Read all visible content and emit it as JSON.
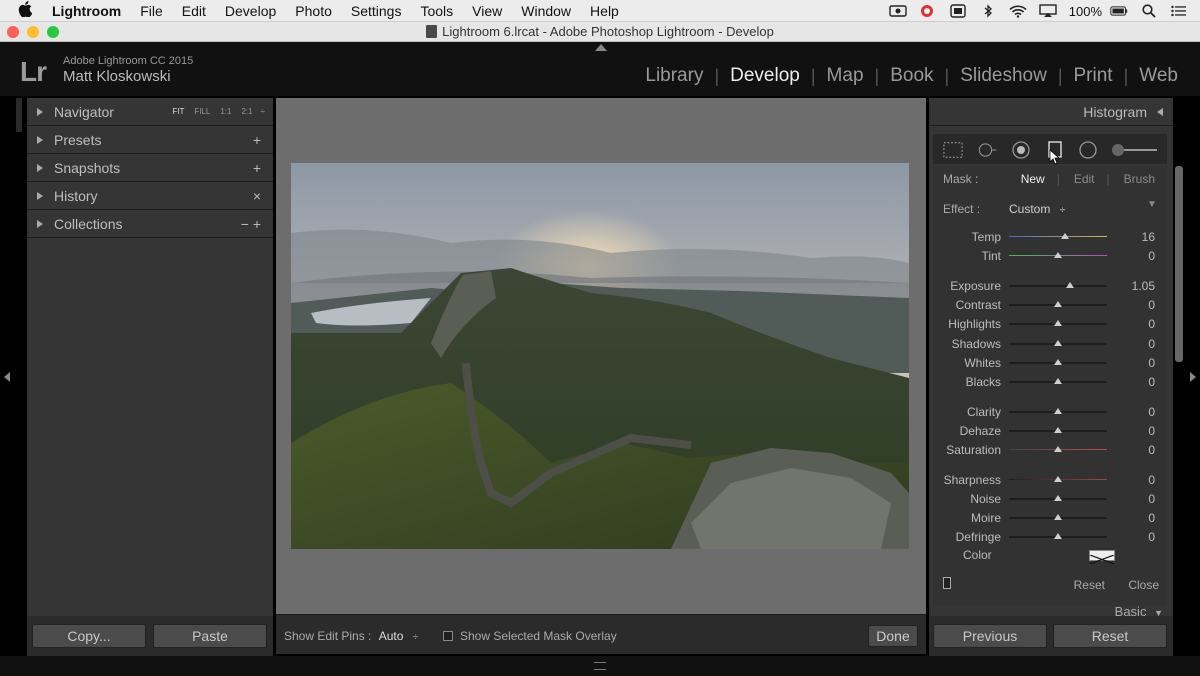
{
  "menubar": {
    "app_name": "Lightroom",
    "items": [
      "File",
      "Edit",
      "Develop",
      "Photo",
      "Settings",
      "Tools",
      "View",
      "Window",
      "Help"
    ],
    "battery": "100%"
  },
  "window": {
    "title": "Lightroom 6.lrcat - Adobe Photoshop Lightroom - Develop"
  },
  "header": {
    "logo": "Lr",
    "product": "Adobe Lightroom CC 2015",
    "user": "Matt Kloskowski",
    "modules": [
      "Library",
      "Develop",
      "Map",
      "Book",
      "Slideshow",
      "Print",
      "Web"
    ],
    "active_module": "Develop"
  },
  "left_panel": {
    "navigator": {
      "label": "Navigator",
      "zoom_options": [
        "FIT",
        "FILL",
        "1:1",
        "2:1"
      ],
      "zoom_more": "÷"
    },
    "sections": [
      {
        "label": "Presets",
        "action": "+"
      },
      {
        "label": "Snapshots",
        "action": "+"
      },
      {
        "label": "History",
        "action": "×"
      },
      {
        "label": "Collections",
        "action": "−  +"
      }
    ],
    "copy_label": "Copy...",
    "paste_label": "Paste"
  },
  "center": {
    "show_edit_pins_label": "Show Edit Pins :",
    "show_edit_pins_value": "Auto",
    "show_edit_pins_arrow": "÷",
    "overlay_label": "Show Selected Mask Overlay",
    "done_label": "Done"
  },
  "right_panel": {
    "histogram_label": "Histogram",
    "mask_label": "Mask :",
    "mask_options": [
      "New",
      "Edit",
      "Brush"
    ],
    "mask_active": "New",
    "effect_label": "Effect :",
    "effect_value": "Custom",
    "effect_arrow": "÷",
    "effect_collapse": "▼",
    "sliders": [
      {
        "label": "Temp",
        "value": "16",
        "pos": 0.57
      },
      {
        "label": "Tint",
        "value": "0",
        "pos": 0.5
      },
      {
        "label": "Exposure",
        "value": "1.05",
        "pos": 0.62
      },
      {
        "label": "Contrast",
        "value": "0",
        "pos": 0.5
      },
      {
        "label": "Highlights",
        "value": "0",
        "pos": 0.5
      },
      {
        "label": "Shadows",
        "value": "0",
        "pos": 0.5
      },
      {
        "label": "Whites",
        "value": "0",
        "pos": 0.5
      },
      {
        "label": "Blacks",
        "value": "0",
        "pos": 0.5
      },
      {
        "label": "Clarity",
        "value": "0",
        "pos": 0.5
      },
      {
        "label": "Dehaze",
        "value": "0",
        "pos": 0.5
      },
      {
        "label": "Saturation",
        "value": "0",
        "pos": 0.5
      },
      {
        "label": "Sharpness",
        "value": "0",
        "pos": 0.5
      },
      {
        "label": "Noise",
        "value": "0",
        "pos": 0.5
      },
      {
        "label": "Moire",
        "value": "0",
        "pos": 0.5
      },
      {
        "label": "Defringe",
        "value": "0",
        "pos": 0.5
      }
    ],
    "color_label": "Color",
    "reset_label": "Reset",
    "close_label": "Close",
    "basic_label": "Basic",
    "basic_arrow": "▼",
    "previous_label": "Previous",
    "reset_button_label": "Reset"
  },
  "colors": {
    "panel_bg": "#353535",
    "active_text": "#eeeeee",
    "light_red": "#fe5f57",
    "light_yellow": "#febc2e",
    "light_green": "#28c840"
  }
}
